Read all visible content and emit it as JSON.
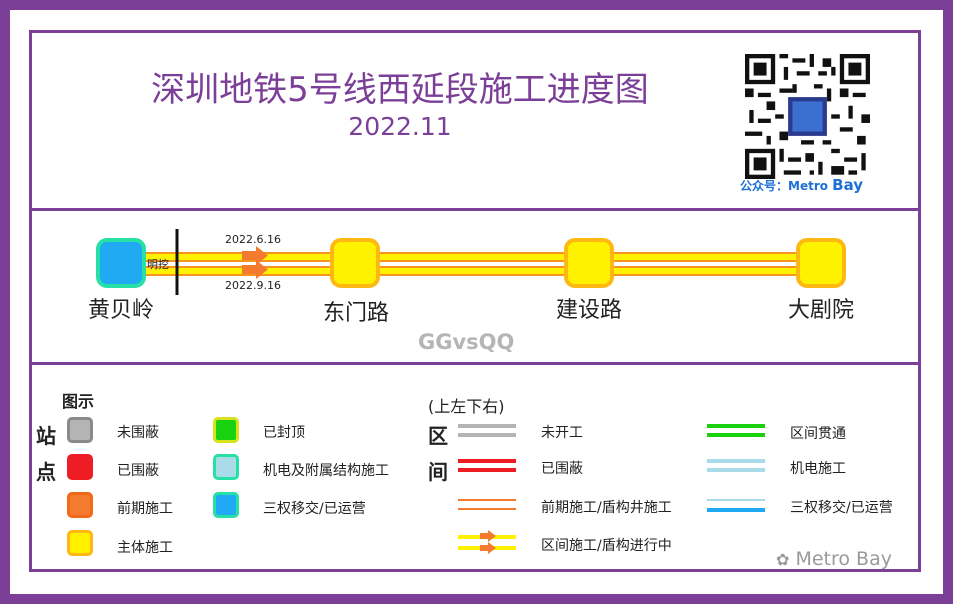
{
  "title": "深圳地铁5号线西延段施工进度图",
  "date": "2022.11",
  "qr_caption_prefix": "公众号：",
  "qr_caption_name_a": "Metro ",
  "qr_caption_name_b": "Bay",
  "stations": [
    {
      "name": "黄贝岭",
      "status": "三权移交/已运营"
    },
    {
      "name": "东门路",
      "status": "主体施工"
    },
    {
      "name": "建设路",
      "status": "主体施工"
    },
    {
      "name": "大剧院",
      "status": "主体施工"
    }
  ],
  "cut_label": "明挖",
  "tunnel_dates": {
    "upper": "2022.6.16",
    "lower": "2022.9.16"
  },
  "watermark": "GGvsQQ",
  "legend": {
    "title": "图示",
    "station_side": [
      "站",
      "点"
    ],
    "section_side": [
      "区",
      "间"
    ],
    "section_note": "(上左下右)",
    "station_items": [
      {
        "label": "未围蔽",
        "fill": "#b4b4b4",
        "border": "#8a8a8a"
      },
      {
        "label": "已围蔽",
        "fill": "#ee1c25",
        "border": "#ee1c25"
      },
      {
        "label": "前期施工",
        "fill": "#f47a30",
        "border": "#f06a1a"
      },
      {
        "label": "主体施工",
        "fill": "#fff200",
        "border": "#fdb813"
      },
      {
        "label": "已封顶",
        "fill": "#18d10f",
        "border": "#d7e21c"
      },
      {
        "label": "机电及附属结构施工",
        "fill": "#a9dbe9",
        "border": "#27e0a6"
      },
      {
        "label": "三权移交/已运营",
        "fill": "#21aaf4",
        "border": "#27e0a6"
      }
    ],
    "section_items": [
      {
        "label": "未开工"
      },
      {
        "label": "已围蔽"
      },
      {
        "label": "前期施工/盾构井施工"
      },
      {
        "label": "区间施工/盾构进行中"
      },
      {
        "label": "区间贯通"
      },
      {
        "label": "机电施工"
      },
      {
        "label": "三权移交/已运营"
      }
    ]
  },
  "corner_watermark": "Metro Bay",
  "colors": {
    "frame": "#7b3f98",
    "track_yellow": "#fff200",
    "track_orange": "#f7941d",
    "arrow": "#f47a30"
  }
}
